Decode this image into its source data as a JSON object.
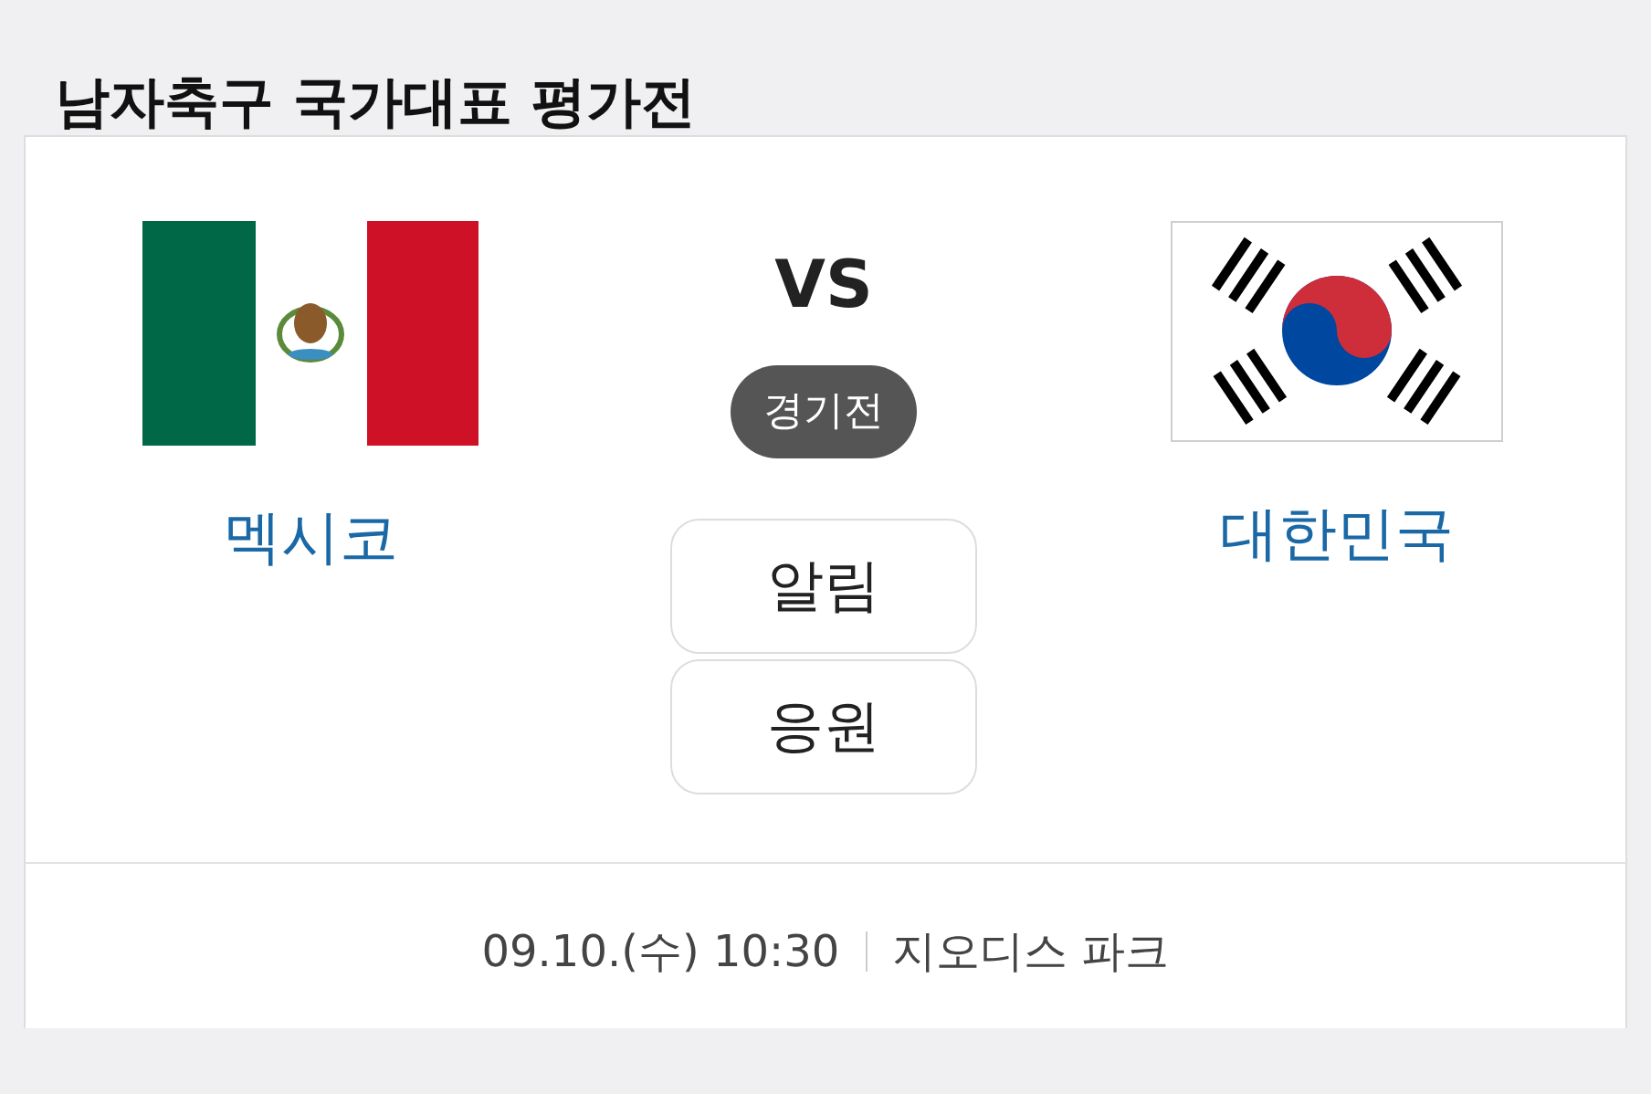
{
  "title": "남자축구 국가대표 평가전",
  "teams": [
    {
      "name": "멕시코"
    },
    {
      "name": "대한민국"
    }
  ],
  "vs": "VS",
  "status": "경기전",
  "buttons": [
    "알림",
    "응원"
  ],
  "info": {
    "datetime": "09.10.(수) 10:30",
    "venue": "지오디스 파크"
  }
}
